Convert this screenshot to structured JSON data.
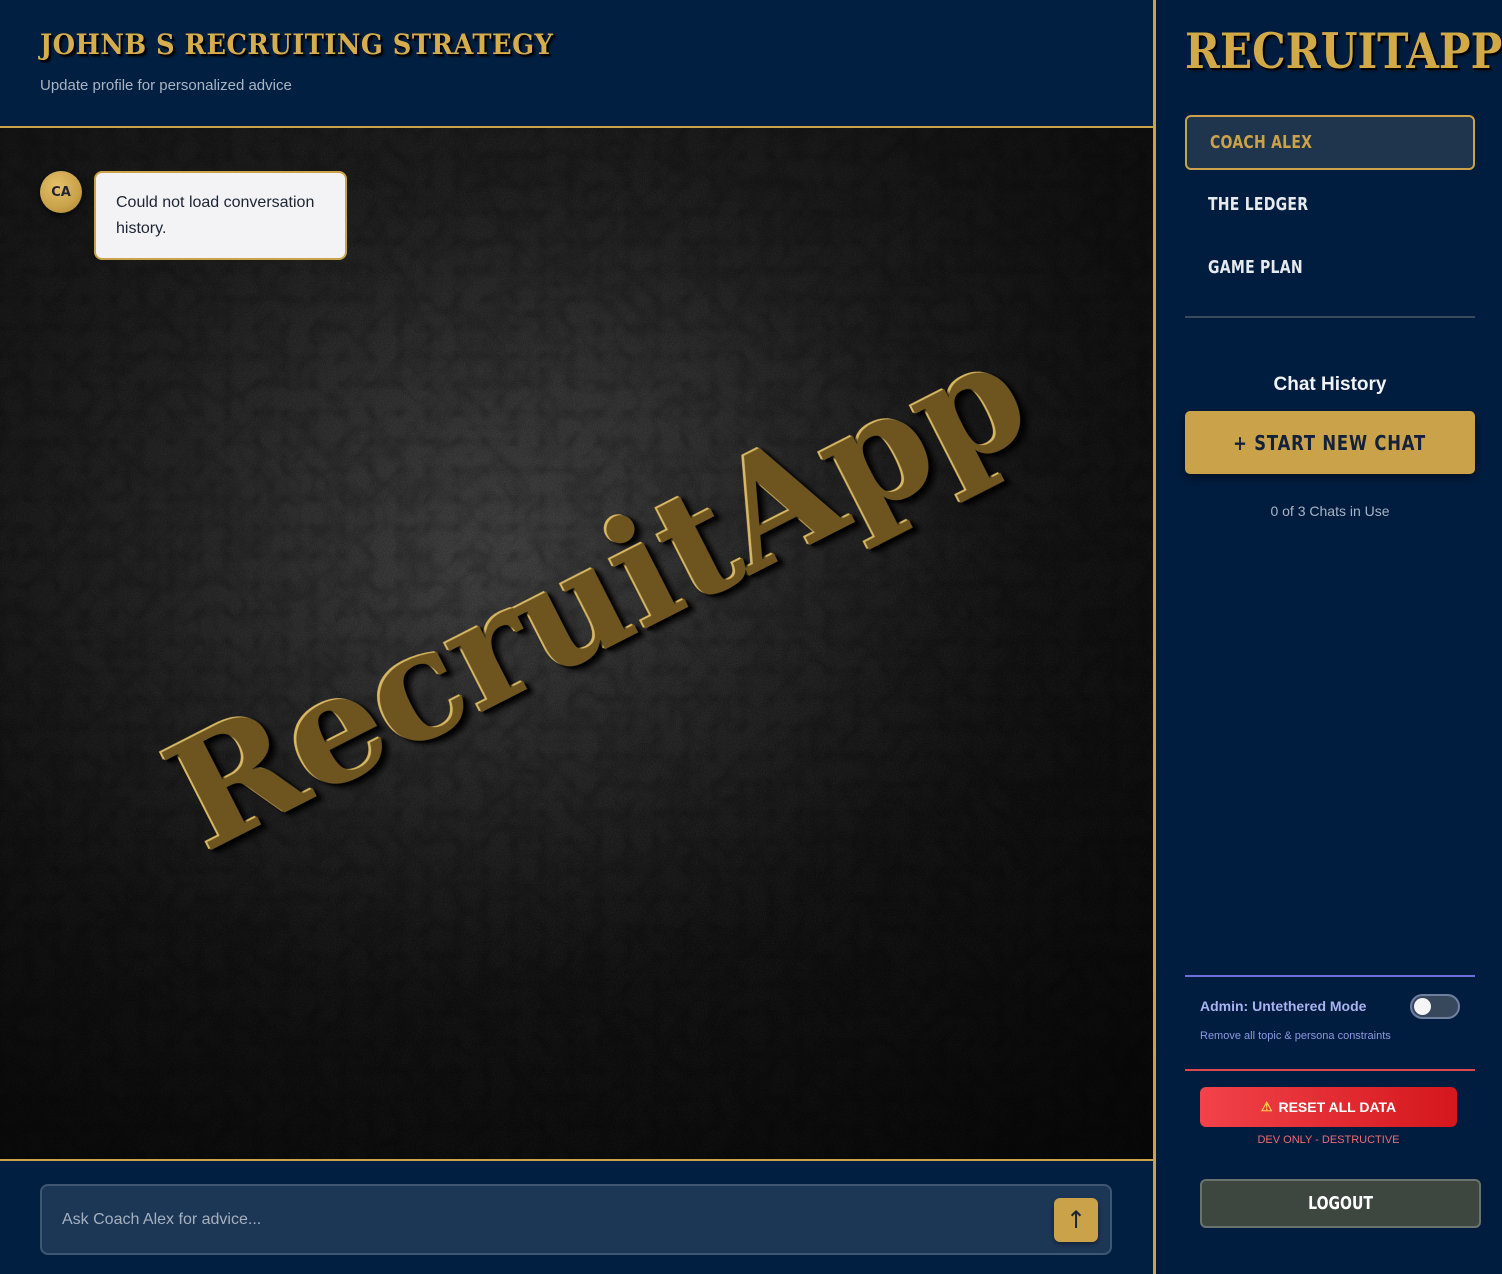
{
  "header": {
    "title": "JOHNB S RECRUITING STRATEGY",
    "subtitle": "Update profile for personalized advice"
  },
  "chat": {
    "watermark": "RecruitApp",
    "messages": [
      {
        "avatar_initials": "CA",
        "text": "Could not load conversation history."
      }
    ]
  },
  "composer": {
    "placeholder": "Ask Coach Alex for advice...",
    "send_icon": "↑"
  },
  "sidebar": {
    "brand": "RECRUITAPP",
    "nav": [
      {
        "label": "COACH ALEX",
        "active": true
      },
      {
        "label": "THE LEDGER",
        "active": false
      },
      {
        "label": "GAME PLAN",
        "active": false
      }
    ],
    "history_title": "Chat History",
    "new_chat_label": "+ START NEW CHAT",
    "chat_count": "0 of 3 Chats in Use",
    "admin": {
      "label": "Admin: Untethered Mode",
      "description": "Remove all topic & persona constraints",
      "toggle_on": false
    },
    "reset": {
      "icon": "⚠",
      "label": "RESET ALL DATA",
      "note": "DEV ONLY - DESTRUCTIVE"
    },
    "logout_label": "LOGOUT"
  },
  "colors": {
    "navy": "#001f3f",
    "gold": "#c9a24a",
    "danger": "#e0262c",
    "admin_accent": "#6b6fd8"
  }
}
